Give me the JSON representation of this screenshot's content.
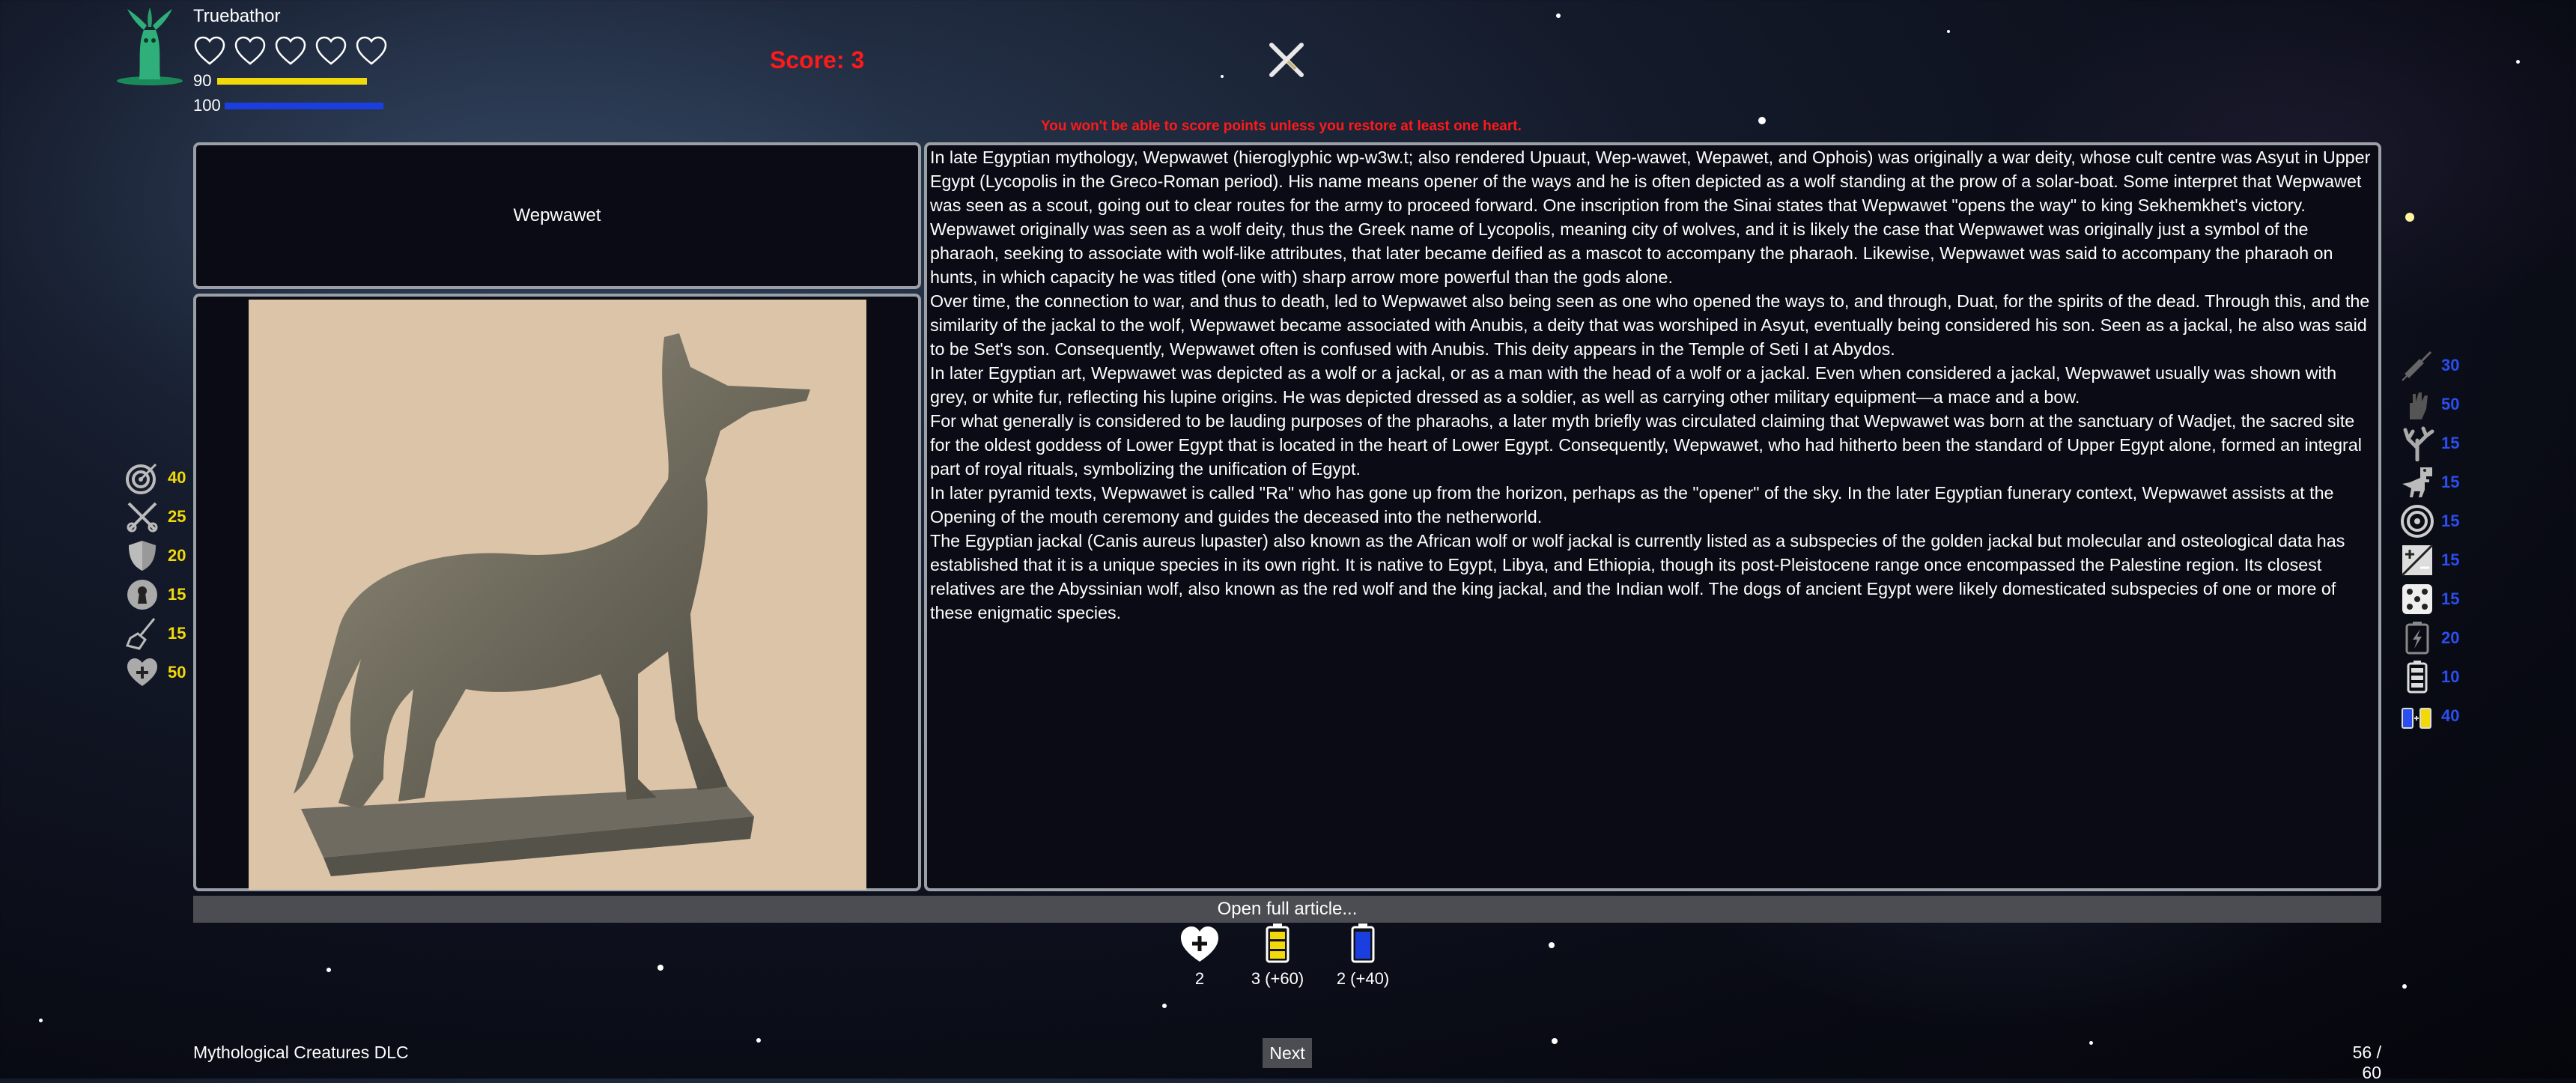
{
  "player": {
    "name": "Truebathor",
    "hearts_total": 5,
    "health": "90",
    "energy": "100"
  },
  "score_text": "Score: 3",
  "warning": "You won't be able to score points unless you restore at least one heart.",
  "creature": {
    "name": "Wepwawet",
    "paragraphs": [
      "In late Egyptian mythology, Wepwawet (hieroglyphic wp-w3w.t; also rendered Upuaut, Wep-wawet, Wepawet, and Ophois) was originally a war deity, whose cult centre was Asyut in Upper Egypt (Lycopolis in the Greco-Roman period). His name means opener of the ways and he is often depicted as a wolf standing at the prow of a solar-boat. Some interpret that Wepwawet was seen as a scout, going out to clear routes for the army to proceed forward. One inscription from the Sinai states that Wepwawet \"opens the way\" to king Sekhemkhet's victory.",
      "Wepwawet originally was seen as a wolf deity, thus the Greek name of Lycopolis, meaning city of wolves, and it is likely the case that Wepwawet was originally just a symbol of the pharaoh, seeking to associate with wolf-like attributes, that later became deified as a mascot to accompany the pharaoh. Likewise, Wepwawet was said to accompany the pharaoh on hunts, in which capacity he was titled (one with) sharp arrow more powerful than the gods alone.",
      "Over time, the connection to war, and thus to death, led to Wepwawet also being seen as one who opened the ways to, and through, Duat, for the spirits of the dead. Through this, and the similarity of the jackal to the wolf, Wepwawet became associated with Anubis, a deity that was worshiped in Asyut, eventually being considered his son. Seen as a jackal, he also was said to be Set's son. Consequently, Wepwawet often is confused with Anubis. This deity appears in the Temple of Seti I at Abydos.",
      "In later Egyptian art, Wepwawet was depicted as a wolf or a jackal, or as a man with the head of a wolf or a jackal. Even when considered a jackal, Wepwawet usually was shown with grey, or white fur, reflecting his lupine origins. He was depicted dressed as a soldier, as well as carrying other military equipment—a mace and a bow.",
      "For what generally is considered to be lauding purposes of the pharaohs, a later myth briefly was circulated claiming that Wepwawet was born at the sanctuary of Wadjet, the sacred site for the oldest goddess of Lower Egypt that is located in the heart of Lower Egypt. Consequently, Wepwawet, who had hitherto been the standard of Upper Egypt alone, formed an integral part of royal rituals, symbolizing the unification of Egypt.",
      "In later pyramid texts, Wepwawet is called \"Ra\" who has gone up from the horizon, perhaps as the \"opener\" of the sky. In the later Egyptian funerary context, Wepwawet assists at the Opening of the mouth ceremony and guides the deceased into the netherworld.",
      "The Egyptian jackal (Canis aureus lupaster) also known as the African wolf or wolf jackal is currently listed as a subspecies of the golden jackal but molecular and osteological data has established that it is a unique species in its own right. It is native to Egypt, Libya, and Ethiopia, though its post-Pleistocene range once encompassed the Palestine region. Its closest relatives are the Abyssinian wolf, also known as the red wolf and the king jackal, and the Indian wolf. The dogs of ancient Egypt were likely domesticated subspecies of one or more of these enigmatic species."
    ]
  },
  "open_article_label": "Open full article...",
  "left_stats": [
    {
      "icon": "target-icon",
      "value": "40"
    },
    {
      "icon": "crossed-swords-icon",
      "value": "25"
    },
    {
      "icon": "shield-icon",
      "value": "20"
    },
    {
      "icon": "keyhole-icon",
      "value": "15"
    },
    {
      "icon": "broom-icon",
      "value": "15"
    },
    {
      "icon": "heart-plus-icon",
      "value": "50"
    }
  ],
  "right_stats": [
    {
      "icon": "syringe-icon",
      "value": "30"
    },
    {
      "icon": "hand-icon",
      "value": "50"
    },
    {
      "icon": "coral-icon",
      "value": "15"
    },
    {
      "icon": "dinosaur-icon",
      "value": "15"
    },
    {
      "icon": "spiral-icon",
      "value": "15"
    },
    {
      "icon": "plus-minus-icon",
      "value": "15"
    },
    {
      "icon": "dice-icon",
      "value": "15"
    },
    {
      "icon": "battery-bolt-icon",
      "value": "20"
    },
    {
      "icon": "battery-icon",
      "value": "10"
    },
    {
      "icon": "battery-pair-icon",
      "value": "40"
    }
  ],
  "inventory": [
    {
      "icon": "heart-plus-icon",
      "label": "2"
    },
    {
      "icon": "yellow-battery-icon",
      "label": "3 (+60)"
    },
    {
      "icon": "blue-battery-icon",
      "label": "2 (+40)"
    }
  ],
  "colors": {
    "health": "#f2d90a",
    "energy": "#1a3ee0",
    "score": "#ff1a1a",
    "panel_border": "#9aa0a6"
  },
  "footer": {
    "dlc_name": "Mythological Creatures DLC",
    "next_label": "Next",
    "progress": "56 / 60"
  }
}
